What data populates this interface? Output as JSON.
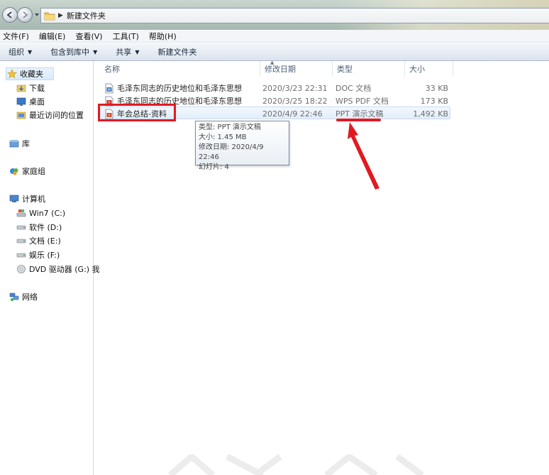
{
  "address": {
    "path": "新建文件夹"
  },
  "menu": [
    "文件(F)",
    "编辑(E)",
    "查看(V)",
    "工具(T)",
    "帮助(H)"
  ],
  "commands": [
    {
      "label": "组织",
      "dropdown": true
    },
    {
      "label": "包含到库中",
      "dropdown": true
    },
    {
      "label": "共享",
      "dropdown": true
    },
    {
      "label": "新建文件夹",
      "dropdown": false
    }
  ],
  "nav": {
    "favorites": "收藏夹",
    "downloads": "下载",
    "desktop": "桌面",
    "recent": "最近访问的位置",
    "libraries": "库",
    "homegroup": "家庭组",
    "computer": "计算机",
    "drives": [
      "Win7 (C:)",
      "软件 (D:)",
      "文档 (E:)",
      "娱乐 (F:)",
      "DVD 驱动器 (G:) 我"
    ],
    "network": "网络"
  },
  "columns": {
    "name": "名称",
    "date": "修改日期",
    "type": "类型",
    "size": "大小"
  },
  "files": [
    {
      "name": "毛泽东同志的历史地位和毛泽东思想",
      "date": "2020/3/23 22:31",
      "type": "DOC 文档",
      "size": "33 KB",
      "icon": "doc-file-icon",
      "color": "#2f6ebf"
    },
    {
      "name": "毛泽东同志的历史地位和毛泽东思想",
      "date": "2020/3/25 18:22",
      "type": "WPS PDF 文档",
      "size": "173 KB",
      "icon": "pdf-file-icon",
      "color": "#d0312d"
    },
    {
      "name": "年会总结-资料",
      "date": "2020/4/9 22:46",
      "type": "PPT 演示文稿",
      "size": "1,492 KB",
      "icon": "ppt-file-icon",
      "color": "#d24726"
    }
  ],
  "tooltip": {
    "type": "类型: PPT 演示文稿",
    "size": "大小: 1.45 MB",
    "modified": "修改日期: 2020/4/9 22:46",
    "slides": "幻灯片: 4"
  },
  "colors": {
    "highlight": "#e11a22",
    "header_text": "#4c607a",
    "selection": "#d9eafb"
  }
}
